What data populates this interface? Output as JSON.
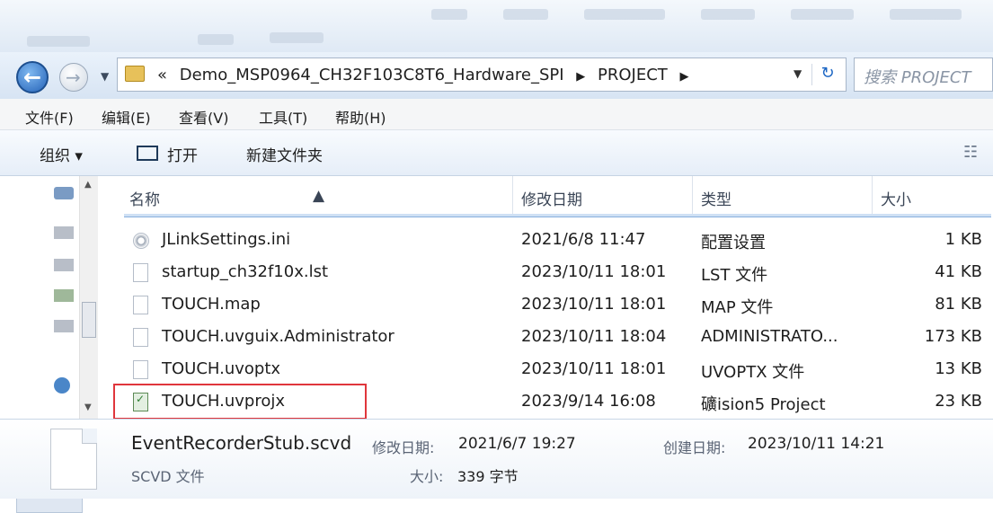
{
  "address_bar": {
    "crumb_prefix": "«",
    "crumbs": [
      "Demo_MSP0964_CH32F103C8T6_Hardware_SPI",
      "PROJECT"
    ],
    "separator": "▶",
    "dropdown": "▼",
    "refresh_icon": "refresh-icon",
    "search_placeholder": "搜索 PROJECT"
  },
  "menu": [
    "文件(F)",
    "编辑(E)",
    "查看(V)",
    "工具(T)",
    "帮助(H)"
  ],
  "command_bar": {
    "organize": "组织 ▾",
    "open": "打开",
    "new_folder": "新建文件夹"
  },
  "columns": {
    "name": "名称",
    "date": "修改日期",
    "type": "类型",
    "size": "大小"
  },
  "files": [
    {
      "name": "JLinkSettings.ini",
      "date": "2021/6/8 11:47",
      "type": "配置设置",
      "size": "1 KB",
      "icon": "settings-file-icon"
    },
    {
      "name": "startup_ch32f10x.lst",
      "date": "2023/10/11 18:01",
      "type": "LST 文件",
      "size": "41 KB",
      "icon": "file-icon"
    },
    {
      "name": "TOUCH.map",
      "date": "2023/10/11 18:01",
      "type": "MAP 文件",
      "size": "81 KB",
      "icon": "file-icon"
    },
    {
      "name": "TOUCH.uvguix.Administrator",
      "date": "2023/10/11 18:04",
      "type": "ADMINISTRATO...",
      "size": "173 KB",
      "icon": "file-icon"
    },
    {
      "name": "TOUCH.uvoptx",
      "date": "2023/10/11 18:01",
      "type": "UVOPTX 文件",
      "size": "13 KB",
      "icon": "file-icon"
    },
    {
      "name": "TOUCH.uvprojx",
      "date": "2023/9/14 16:08",
      "type": "礦ision5 Project",
      "size": "23 KB",
      "icon": "keil-project-icon"
    }
  ],
  "details": {
    "filename": "EventRecorderStub.scvd",
    "modified_label": "修改日期:",
    "modified": "2021/6/7 19:27",
    "created_label": "创建日期:",
    "created": "2023/10/11 14:21",
    "filetype": "SCVD 文件",
    "size_label": "大小:",
    "size": "339 字节"
  },
  "colors": {
    "highlight": "#e0363c",
    "accent": "#2563b8"
  }
}
